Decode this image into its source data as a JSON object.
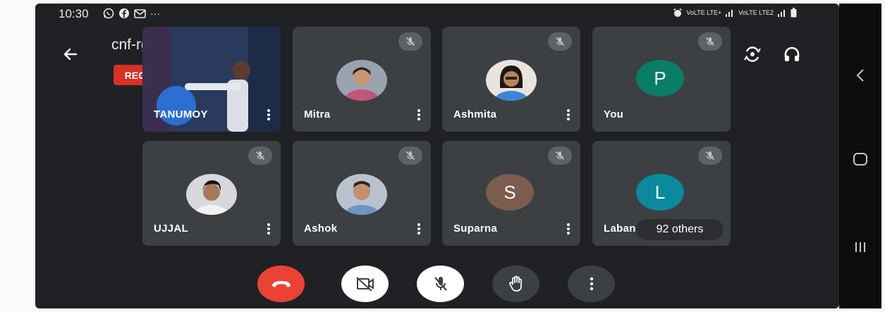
{
  "status_bar": {
    "time": "10:30",
    "left_icons": [
      "whatsapp-icon",
      "facebook-icon",
      "gmail-icon",
      "more-notifications-icon"
    ],
    "more_glyph": "···",
    "network_label_1": "VoLTE LTE+",
    "network_label_2": "VoLTE LTE2"
  },
  "header": {
    "meeting_code": "cnf-rgyb-vwz",
    "rec_label": "REC"
  },
  "participants": [
    {
      "name": "TANUMOY",
      "type": "video"
    },
    {
      "name": "Mitra",
      "type": "photo",
      "muted": true
    },
    {
      "name": "Ashmita",
      "type": "photo",
      "muted": true
    },
    {
      "name": "You",
      "type": "letter",
      "letter": "P",
      "color": "#0a7d67",
      "muted": true
    },
    {
      "name": "UJJAL",
      "type": "photo",
      "muted": true
    },
    {
      "name": "Ashok",
      "type": "photo",
      "muted": true
    },
    {
      "name": "Suparna",
      "type": "letter",
      "letter": "S",
      "color": "#7b5d4e",
      "muted": true
    },
    {
      "name": "Laban",
      "type": "letter",
      "letter": "L",
      "color": "#0b8a9e",
      "muted": true
    }
  ],
  "others_label": "92 others",
  "controls": {
    "end_call_color": "#ea4335",
    "camera_state": "off",
    "mic_state": "muted"
  },
  "colors": {
    "background": "#202124",
    "tile": "#3c4043",
    "rec": "#d93025"
  }
}
